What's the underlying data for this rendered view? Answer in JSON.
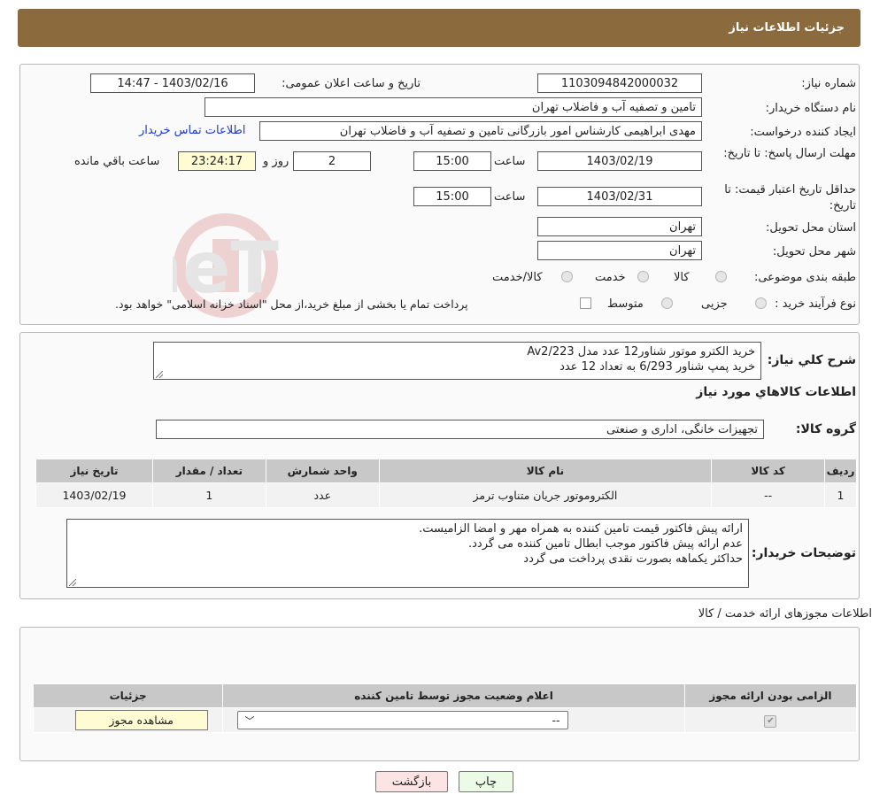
{
  "header": {
    "title": "جزئیات اطلاعات نیاز"
  },
  "info": {
    "need_number_label": "شماره نیاز:",
    "need_number": "1103094842000032",
    "announce_label": "تاریخ و ساعت اعلان عمومی:",
    "announce_value": "1403/02/16 - 14:47",
    "buyer_org_label": "نام دستگاه خریدار:",
    "buyer_org": "تامین و تصفیه آب و فاضلاب تهران",
    "requester_label": "ایجاد کننده درخواست:",
    "requester": "مهدی ابراهیمی کارشناس امور بازرگانی تامین و تصفیه آب و فاضلاب تهران",
    "contact_link": "اطلاعات تماس خریدار",
    "deadline_label": "مهلت ارسال پاسخ: تا تاریخ:",
    "deadline_date": "1403/02/19",
    "time_label": "ساعت",
    "deadline_time": "15:00",
    "days_value": "2",
    "days_label": "روز و",
    "remaining_time": "23:24:17",
    "remaining_label": "ساعت باقي مانده",
    "validity_label": "حداقل تاریخ اعتبار قیمت: تا تاریخ:",
    "validity_date": "1403/02/31",
    "validity_time": "15:00",
    "province_label": "استان محل تحویل:",
    "province": "تهران",
    "city_label": "شهر محل تحویل:",
    "city": "تهران",
    "category_label": "طبقه بندی موضوعی:",
    "category_options": [
      "کالا",
      "خدمت",
      "کالا/خدمت"
    ],
    "process_label": "نوع فرآیند خرید :",
    "process_options": [
      "جزیی",
      "متوسط"
    ],
    "process_note": "پرداخت تمام یا بخشی از مبلغ خرید،از محل \"اسناد خزانه اسلامی\" خواهد بود."
  },
  "details": {
    "summary_label": "شرح کلي نياز:",
    "summary_lines": [
      "خرید الکترو موتور شناور12 عدد مدل Av2/223",
      "خرید پمپ شناور 6/293 به تعداد 12 عدد"
    ],
    "goods_info_title": "اطلاعات کالاهاي مورد نياز",
    "goods_group_label": "گروه کالا:",
    "goods_group": "تجهیزات خانگی، اداری و صنعتی",
    "table_headers": [
      "رديف",
      "کد کالا",
      "نام کالا",
      "واحد شمارش",
      "تعداد / مقدار",
      "تاریخ نیاز"
    ],
    "table_rows": [
      [
        "1",
        "--",
        "الکتروموتور جریان متناوب ترمز",
        "عدد",
        "1",
        "1403/02/19"
      ]
    ],
    "buyer_notes_label": "توضيحات خريدار:",
    "buyer_notes_lines": [
      "ارائه پیش فاکتور قیمت تامین کننده به همراه مهر و امضا الزامیست.",
      "عدم ارائه پیش فاکتور موجب ابطال تامین کننده می گردد.",
      "حداکثر یکماهه بصورت نقدی پرداخت می گردد"
    ]
  },
  "permits": {
    "section_title": "اطلاعات مجوزهای ارائه خدمت / کالا",
    "headers": [
      "الزامی بودن ارائه مجوز",
      "اعلام وضعیت مجوز توسط تامین کننده",
      "جزئیات"
    ],
    "select_value": "--",
    "view_button": "مشاهده مجوز"
  },
  "footer": {
    "print_button": "چاپ",
    "back_button": "بازگشت"
  },
  "colors": {
    "header_bg": "#8b6a3d",
    "link": "#1a3ad1",
    "highlight": "#fffbd2",
    "back_button": "#fde4e4",
    "print_button": "#ecfbe6"
  }
}
